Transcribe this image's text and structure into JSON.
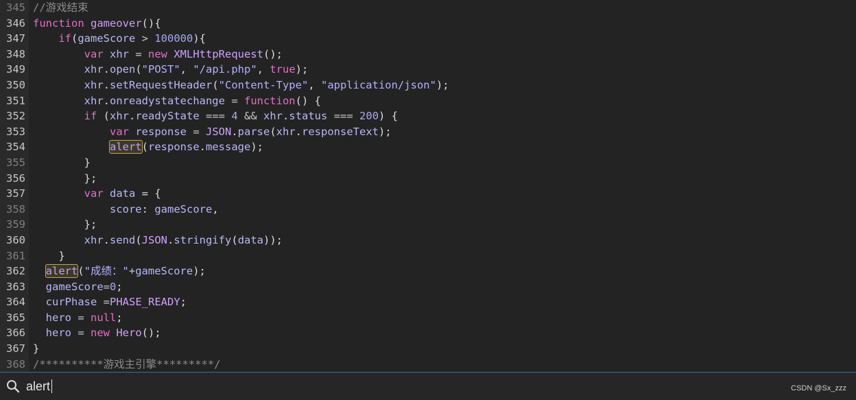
{
  "editor": {
    "lines": [
      {
        "num": "345",
        "tokens": [
          {
            "t": "//游戏结束",
            "c": "cmt"
          }
        ]
      },
      {
        "num": "346",
        "tokens": [
          {
            "t": "function",
            "c": "kw"
          },
          {
            "t": " ",
            "c": "pu"
          },
          {
            "t": "gameover",
            "c": "fn"
          },
          {
            "t": "(){",
            "c": "pu"
          }
        ]
      },
      {
        "num": "347",
        "tokens": [
          {
            "t": "    ",
            "c": "pu"
          },
          {
            "t": "if",
            "c": "kw"
          },
          {
            "t": "(",
            "c": "pu"
          },
          {
            "t": "gameScore",
            "c": "id"
          },
          {
            "t": " > ",
            "c": "op"
          },
          {
            "t": "100000",
            "c": "num"
          },
          {
            "t": "){",
            "c": "pu"
          }
        ]
      },
      {
        "num": "348",
        "tokens": [
          {
            "t": "        ",
            "c": "pu"
          },
          {
            "t": "var",
            "c": "kw"
          },
          {
            "t": " ",
            "c": "pu"
          },
          {
            "t": "xhr",
            "c": "id"
          },
          {
            "t": " = ",
            "c": "op"
          },
          {
            "t": "new",
            "c": "kw"
          },
          {
            "t": " ",
            "c": "pu"
          },
          {
            "t": "XMLHttpRequest",
            "c": "cls"
          },
          {
            "t": "();",
            "c": "pu"
          }
        ]
      },
      {
        "num": "349",
        "tokens": [
          {
            "t": "        ",
            "c": "pu"
          },
          {
            "t": "xhr",
            "c": "id"
          },
          {
            "t": ".",
            "c": "pu"
          },
          {
            "t": "open",
            "c": "prop"
          },
          {
            "t": "(",
            "c": "pu"
          },
          {
            "t": "\"POST\"",
            "c": "str"
          },
          {
            "t": ", ",
            "c": "pu"
          },
          {
            "t": "\"/api.php\"",
            "c": "str"
          },
          {
            "t": ", ",
            "c": "pu"
          },
          {
            "t": "true",
            "c": "kw"
          },
          {
            "t": ");",
            "c": "pu"
          }
        ]
      },
      {
        "num": "350",
        "tokens": [
          {
            "t": "        ",
            "c": "pu"
          },
          {
            "t": "xhr",
            "c": "id"
          },
          {
            "t": ".",
            "c": "pu"
          },
          {
            "t": "setRequestHeader",
            "c": "prop"
          },
          {
            "t": "(",
            "c": "pu"
          },
          {
            "t": "\"Content-Type\"",
            "c": "str"
          },
          {
            "t": ", ",
            "c": "pu"
          },
          {
            "t": "\"application/json\"",
            "c": "str"
          },
          {
            "t": ");",
            "c": "pu"
          }
        ]
      },
      {
        "num": "351",
        "tokens": [
          {
            "t": "        ",
            "c": "pu"
          },
          {
            "t": "xhr",
            "c": "id"
          },
          {
            "t": ".",
            "c": "pu"
          },
          {
            "t": "onreadystatechange",
            "c": "prop"
          },
          {
            "t": " = ",
            "c": "op"
          },
          {
            "t": "function",
            "c": "kw"
          },
          {
            "t": "() {",
            "c": "pu"
          }
        ]
      },
      {
        "num": "352",
        "tokens": [
          {
            "t": "        ",
            "c": "pu"
          },
          {
            "t": "if",
            "c": "kw"
          },
          {
            "t": " (",
            "c": "pu"
          },
          {
            "t": "xhr",
            "c": "id"
          },
          {
            "t": ".",
            "c": "pu"
          },
          {
            "t": "readyState",
            "c": "prop"
          },
          {
            "t": " === ",
            "c": "op"
          },
          {
            "t": "4",
            "c": "num"
          },
          {
            "t": " && ",
            "c": "op"
          },
          {
            "t": "xhr",
            "c": "id"
          },
          {
            "t": ".",
            "c": "pu"
          },
          {
            "t": "status",
            "c": "prop"
          },
          {
            "t": " === ",
            "c": "op"
          },
          {
            "t": "200",
            "c": "num"
          },
          {
            "t": ") {",
            "c": "pu"
          }
        ]
      },
      {
        "num": "353",
        "tokens": [
          {
            "t": "            ",
            "c": "pu"
          },
          {
            "t": "var",
            "c": "kw"
          },
          {
            "t": " ",
            "c": "pu"
          },
          {
            "t": "response",
            "c": "id"
          },
          {
            "t": " = ",
            "c": "op"
          },
          {
            "t": "JSON",
            "c": "cls"
          },
          {
            "t": ".",
            "c": "pu"
          },
          {
            "t": "parse",
            "c": "prop"
          },
          {
            "t": "(",
            "c": "pu"
          },
          {
            "t": "xhr",
            "c": "id"
          },
          {
            "t": ".",
            "c": "pu"
          },
          {
            "t": "responseText",
            "c": "prop"
          },
          {
            "t": ");",
            "c": "pu"
          }
        ]
      },
      {
        "num": "354",
        "tokens": [
          {
            "t": "            ",
            "c": "pu"
          },
          {
            "t": "alert",
            "c": "fn",
            "hl": true
          },
          {
            "t": "(",
            "c": "pu"
          },
          {
            "t": "response",
            "c": "id"
          },
          {
            "t": ".",
            "c": "pu"
          },
          {
            "t": "message",
            "c": "prop"
          },
          {
            "t": ");",
            "c": "pu"
          }
        ]
      },
      {
        "num": "355",
        "tokens": [
          {
            "t": "        }",
            "c": "pu"
          }
        ]
      },
      {
        "num": "356",
        "tokens": [
          {
            "t": "        };",
            "c": "pu"
          }
        ]
      },
      {
        "num": "357",
        "tokens": [
          {
            "t": "        ",
            "c": "pu"
          },
          {
            "t": "var",
            "c": "kw"
          },
          {
            "t": " ",
            "c": "pu"
          },
          {
            "t": "data",
            "c": "id"
          },
          {
            "t": " = {",
            "c": "pu"
          }
        ]
      },
      {
        "num": "358",
        "tokens": [
          {
            "t": "            ",
            "c": "pu"
          },
          {
            "t": "score",
            "c": "prop"
          },
          {
            "t": ": ",
            "c": "pu"
          },
          {
            "t": "gameScore",
            "c": "id"
          },
          {
            "t": ",",
            "c": "pu"
          }
        ]
      },
      {
        "num": "359",
        "tokens": [
          {
            "t": "        };",
            "c": "pu"
          }
        ]
      },
      {
        "num": "360",
        "tokens": [
          {
            "t": "        ",
            "c": "pu"
          },
          {
            "t": "xhr",
            "c": "id"
          },
          {
            "t": ".",
            "c": "pu"
          },
          {
            "t": "send",
            "c": "prop"
          },
          {
            "t": "(",
            "c": "pu"
          },
          {
            "t": "JSON",
            "c": "cls"
          },
          {
            "t": ".",
            "c": "pu"
          },
          {
            "t": "stringify",
            "c": "prop"
          },
          {
            "t": "(",
            "c": "pu"
          },
          {
            "t": "data",
            "c": "id"
          },
          {
            "t": "));",
            "c": "pu"
          }
        ]
      },
      {
        "num": "361",
        "tokens": [
          {
            "t": "    }",
            "c": "pu"
          }
        ]
      },
      {
        "num": "362",
        "tokens": [
          {
            "t": "  ",
            "c": "pu"
          },
          {
            "t": "alert",
            "c": "fn",
            "hl": true
          },
          {
            "t": "(",
            "c": "pu"
          },
          {
            "t": "\"成绩：\"",
            "c": "str"
          },
          {
            "t": "+",
            "c": "op"
          },
          {
            "t": "gameScore",
            "c": "id"
          },
          {
            "t": ");",
            "c": "pu"
          }
        ]
      },
      {
        "num": "363",
        "tokens": [
          {
            "t": "  ",
            "c": "pu"
          },
          {
            "t": "gameScore",
            "c": "id"
          },
          {
            "t": "=",
            "c": "op"
          },
          {
            "t": "0",
            "c": "num"
          },
          {
            "t": ";",
            "c": "pu"
          }
        ]
      },
      {
        "num": "364",
        "tokens": [
          {
            "t": "  ",
            "c": "pu"
          },
          {
            "t": "curPhase",
            "c": "id"
          },
          {
            "t": " =",
            "c": "op"
          },
          {
            "t": "PHASE_READY",
            "c": "cls"
          },
          {
            "t": ";",
            "c": "pu"
          }
        ]
      },
      {
        "num": "365",
        "tokens": [
          {
            "t": "  ",
            "c": "pu"
          },
          {
            "t": "hero",
            "c": "id"
          },
          {
            "t": " = ",
            "c": "op"
          },
          {
            "t": "null",
            "c": "kw"
          },
          {
            "t": ";",
            "c": "pu"
          }
        ]
      },
      {
        "num": "366",
        "tokens": [
          {
            "t": "  ",
            "c": "pu"
          },
          {
            "t": "hero",
            "c": "id"
          },
          {
            "t": " = ",
            "c": "op"
          },
          {
            "t": "new",
            "c": "kw"
          },
          {
            "t": " ",
            "c": "pu"
          },
          {
            "t": "Hero",
            "c": "cls"
          },
          {
            "t": "();",
            "c": "pu"
          }
        ]
      },
      {
        "num": "367",
        "tokens": [
          {
            "t": "}",
            "c": "pu"
          }
        ]
      },
      {
        "num": "368",
        "tokens": [
          {
            "t": "/**********游戏主引擎*********/",
            "c": "cmt"
          }
        ]
      }
    ],
    "active_line_numbers": [
      "346",
      "347",
      "348",
      "349",
      "350",
      "351",
      "352",
      "353",
      "354",
      "356",
      "357",
      "360",
      "362",
      "363",
      "364",
      "365",
      "366",
      "367"
    ]
  },
  "search": {
    "value": "alert",
    "icon": "search-icon"
  },
  "watermark": "CSDN @Sx_zzz",
  "colors": {
    "background": "#232323",
    "gutter": "#2a2a2a",
    "keyword": "#e070c8",
    "highlight_border": "#c8a64a",
    "search_border": "#3a6ea8"
  }
}
